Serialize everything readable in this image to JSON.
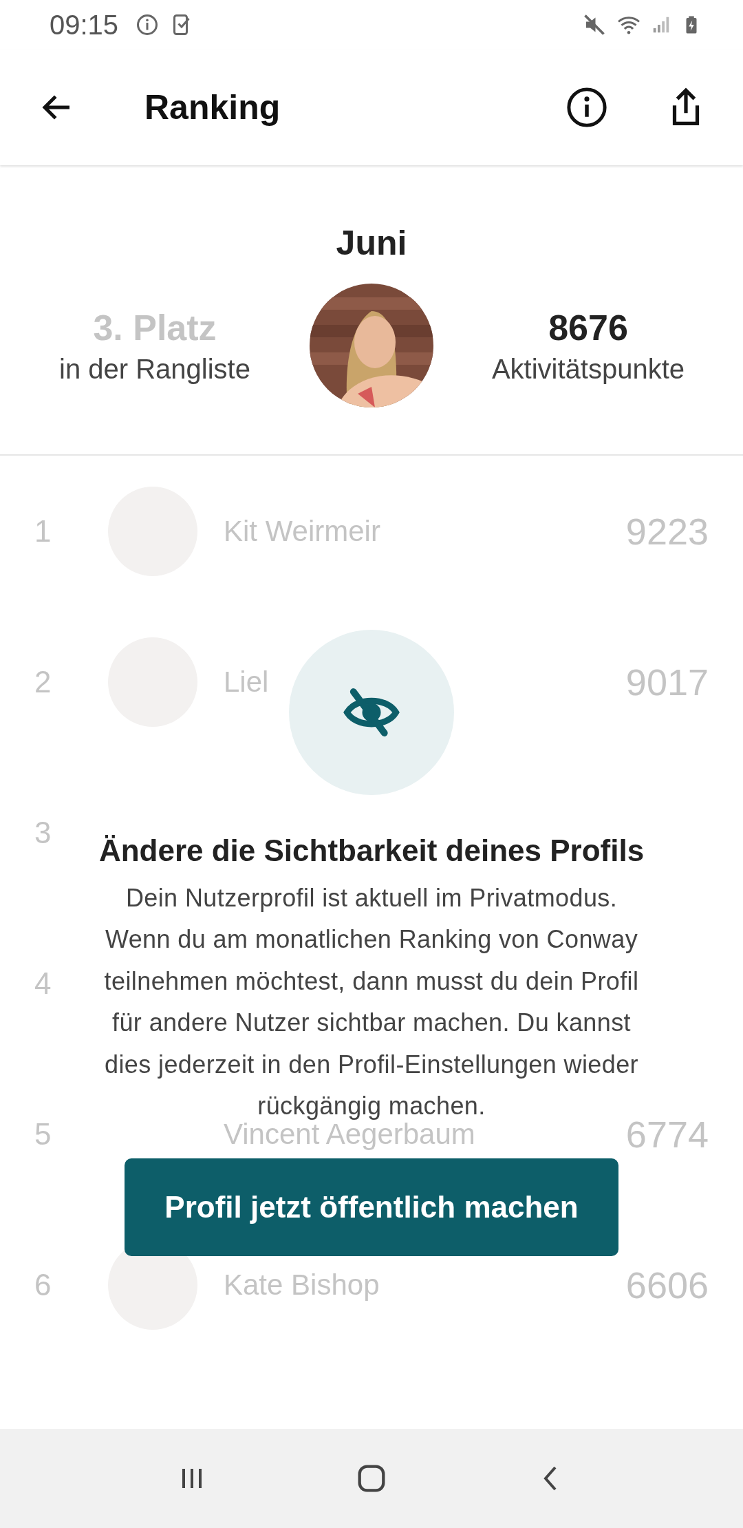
{
  "status_bar": {
    "time": "09:15"
  },
  "app_bar": {
    "title": "Ranking"
  },
  "summary": {
    "month": "Juni",
    "rank": "3. Platz",
    "rank_label": "in der Rangliste",
    "points": "8676",
    "points_label": "Aktivitätspunkte"
  },
  "ranking": [
    {
      "rank": "1",
      "name": "Kit Weirmeir",
      "points": "9223",
      "avatar": true
    },
    {
      "rank": "2",
      "name": "Liel",
      "points": "9017",
      "avatar": true
    },
    {
      "rank": "3",
      "avatar": false
    },
    {
      "rank": "4",
      "avatar": false
    },
    {
      "rank": "5",
      "name": "Vincent Aegerbaum",
      "points": "6774",
      "avatar": false
    },
    {
      "rank": "6",
      "name": "Kate Bishop",
      "points": "6606",
      "avatar": true
    }
  ],
  "privacy_notice": {
    "title": "Ändere die Sichtbarkeit deines Profils",
    "text": "Dein Nutzerprofil ist aktuell im Privatmodus.\nWenn du am monatlichen Ranking von Conway\nteilnehmen möchtest, dann musst du dein Profil\nfür andere Nutzer sichtbar machen. Du kannst\ndies jederzeit in den Profil-Einstellungen wieder\nrückgängig machen.",
    "button": "Profil jetzt öffentlich machen"
  }
}
